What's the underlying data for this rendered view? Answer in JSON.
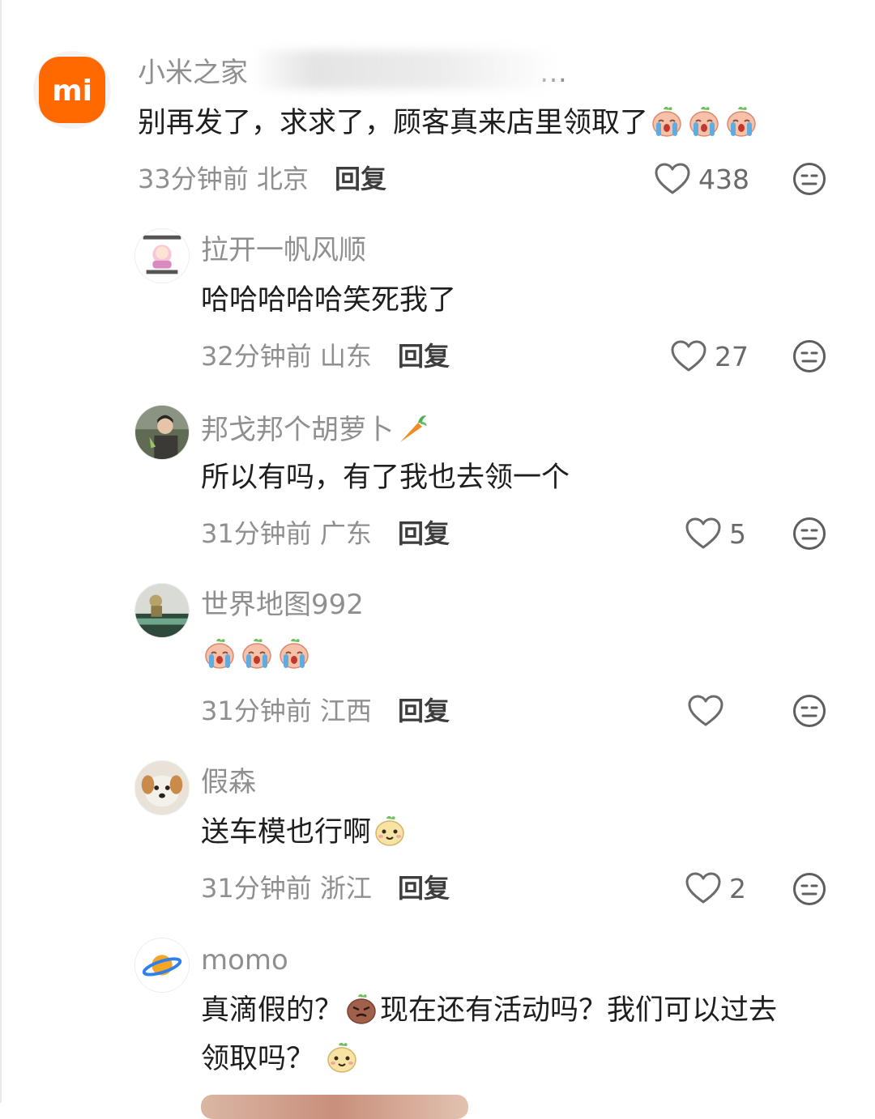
{
  "comments": [
    {
      "username": "小米之家",
      "username_suffix": "…",
      "text": "别再发了，求求了，顾客真来店里领取了",
      "time": "33分钟前",
      "location": "北京",
      "reply_label": "回复",
      "likes": "438",
      "avatar_icon": "xiaomi-logo",
      "logo_text": "mi",
      "emojis": [
        "crying-emoji",
        "crying-emoji",
        "crying-emoji"
      ]
    },
    {
      "username": "拉开一帆风顺",
      "text": "哈哈哈哈哈笑死我了",
      "time": "32分钟前",
      "location": "山东",
      "reply_label": "回复",
      "likes": "27",
      "avatar_icon": "anime-girl-avatar"
    },
    {
      "username": "邦戈邦个胡萝卜",
      "text": "所以有吗，有了我也去领一个",
      "time": "31分钟前",
      "location": "广东",
      "reply_label": "回复",
      "likes": "5",
      "avatar_icon": "person-photo-avatar",
      "name_emoji": "carrot-emoji"
    },
    {
      "username": "世界地图992",
      "text": "",
      "time": "31分钟前",
      "location": "江西",
      "reply_label": "回复",
      "likes": "",
      "avatar_icon": "figure-photo-avatar",
      "emojis": [
        "crying-emoji",
        "crying-emoji",
        "crying-emoji"
      ]
    },
    {
      "username": "假森",
      "text": "送车模也行啊",
      "time": "31分钟前",
      "location": "浙江",
      "reply_label": "回复",
      "likes": "2",
      "avatar_icon": "dog-photo-avatar",
      "emojis": [
        "smile-emoji"
      ]
    },
    {
      "username": "momo",
      "text_part1": "真滴假的？",
      "text_part2": "现在还有活动吗？我们可以过去",
      "text_line2": "领取吗？",
      "avatar_icon": "planet-avatar",
      "emojis": [
        "angry-emoji",
        "smile-emoji"
      ]
    }
  ],
  "colors": {
    "xiaomi_orange": "#ff6900",
    "meta_gray": "#8f8f8f",
    "text": "#1e1e1e"
  }
}
